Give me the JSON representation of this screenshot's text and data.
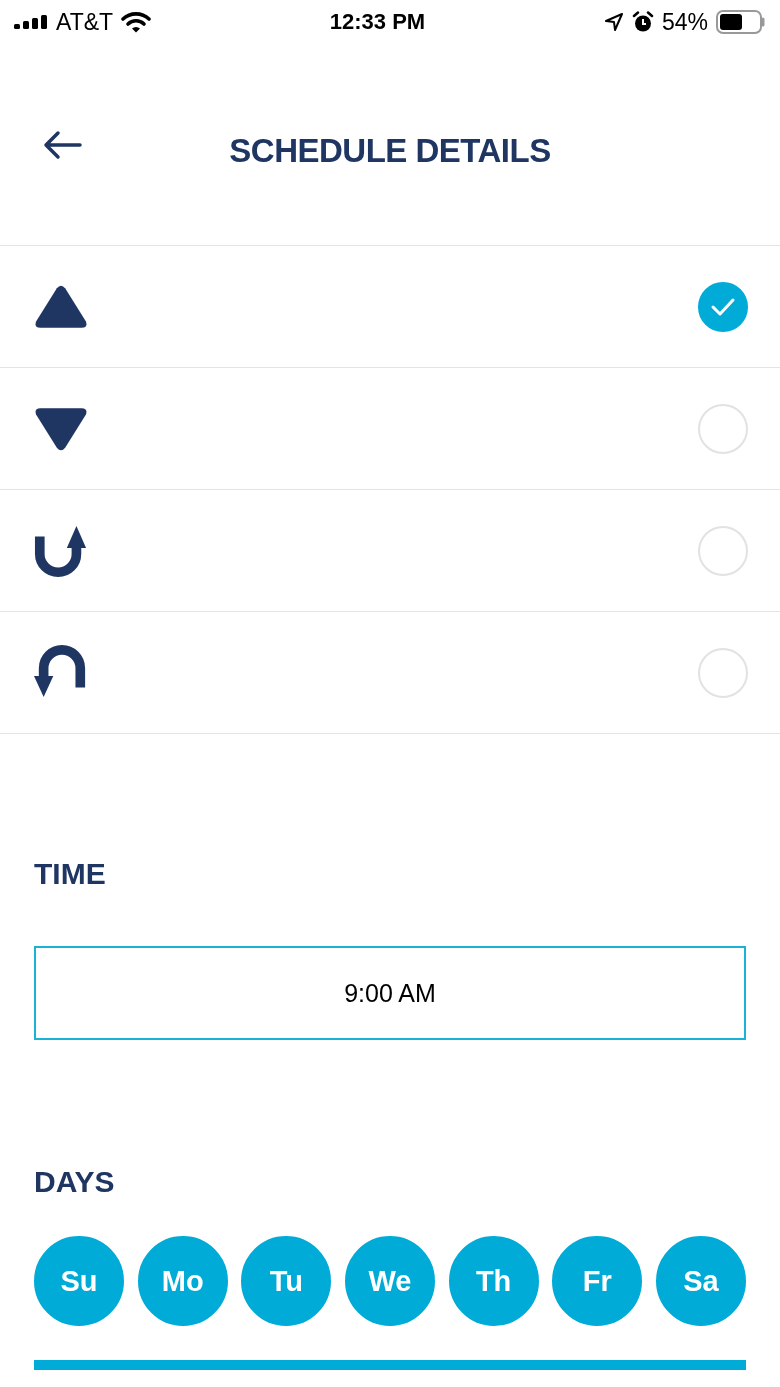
{
  "status_bar": {
    "carrier": "AT&T",
    "time": "12:33 PM",
    "battery": "54%"
  },
  "header": {
    "title": "SCHEDULE DETAILS"
  },
  "options": [
    {
      "kind": "up",
      "selected": true
    },
    {
      "kind": "down",
      "selected": false
    },
    {
      "kind": "turn-up",
      "selected": false
    },
    {
      "kind": "turn-down",
      "selected": false
    }
  ],
  "time": {
    "label": "TIME",
    "value": "9:00 AM"
  },
  "days": {
    "label": "DAYS",
    "items": [
      {
        "label": "Su",
        "selected": true
      },
      {
        "label": "Mo",
        "selected": true
      },
      {
        "label": "Tu",
        "selected": true
      },
      {
        "label": "We",
        "selected": true
      },
      {
        "label": "Th",
        "selected": true
      },
      {
        "label": "Fr",
        "selected": true
      },
      {
        "label": "Sa",
        "selected": true
      }
    ]
  }
}
